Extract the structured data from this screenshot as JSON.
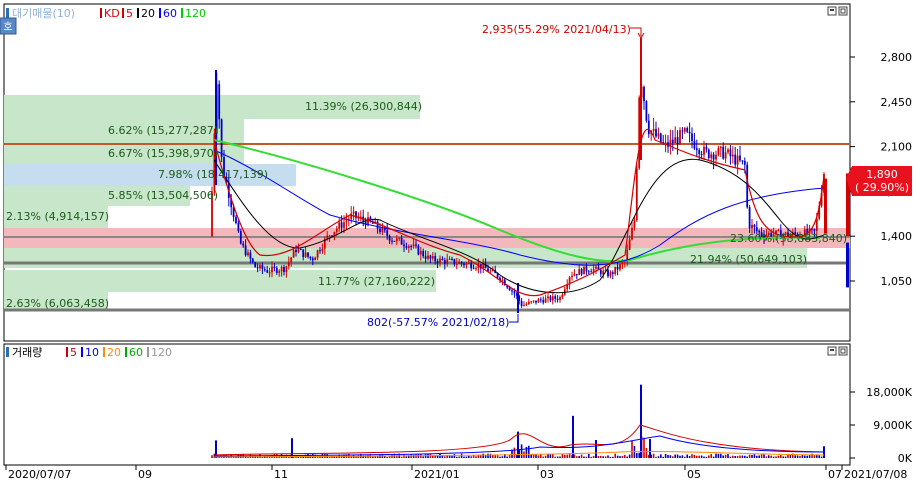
{
  "legend_price": {
    "title": "대기매물(10)",
    "items": [
      {
        "name": "KD",
        "color": "#d40000"
      },
      {
        "name": "5",
        "color": "#d40000"
      },
      {
        "name": "20",
        "color": "#000000"
      },
      {
        "name": "60",
        "color": "#0000ff"
      },
      {
        "name": "120",
        "color": "#00cc00"
      }
    ]
  },
  "legend_volume": {
    "title": "거래량",
    "items": [
      {
        "name": "5",
        "color": "#d40000"
      },
      {
        "name": "10",
        "color": "#0000ff"
      },
      {
        "name": "20",
        "color": "#ff8c00"
      },
      {
        "name": "60",
        "color": "#00aa00"
      },
      {
        "name": "120",
        "color": "#999999"
      }
    ]
  },
  "side_button": "호",
  "price_axis_labels": [
    "2,800",
    "2,450",
    "2,100",
    "1,750",
    "1,400",
    "1,050"
  ],
  "volume_axis_labels": [
    "18,000K",
    "9,000K",
    "0K"
  ],
  "date_labels": [
    "2020/07/07",
    "09",
    "11",
    "2021/01",
    "03",
    "05",
    "07",
    "2021/07/08"
  ],
  "current_price": {
    "price": "1,890",
    "change": "( 29.90%)"
  },
  "annotations": {
    "high": "2,935(55.29% 2021/04/13)",
    "low": "802(-57.57% 2021/02/18)"
  },
  "volume_profile": [
    {
      "label": "11.39% (26,300,844)"
    },
    {
      "label": "6.62% (15,277,287)"
    },
    {
      "label": "6.67% (15,398,970)"
    },
    {
      "label": "7.98% (18,417,139)"
    },
    {
      "label": "5.85% (13,504,506)"
    },
    {
      "label": "2.13% (4,914,157)"
    },
    {
      "label": "23.60% (53,883,840)"
    },
    {
      "label": "21.94% (50,649,103)"
    },
    {
      "label": "11.77% (27,160,222)"
    },
    {
      "label": "2.63% (6,063,458)"
    }
  ],
  "chart_data": {
    "type": "candlestick",
    "price_axis": {
      "ticks": [
        2800,
        2450,
        2100,
        1750,
        1400,
        1050
      ]
    },
    "volume_axis": {
      "ticks": [
        18000,
        9000,
        0
      ],
      "unit": "K"
    },
    "high": 2935,
    "low": 802,
    "last_close": 1890,
    "moving_averages": [
      "5",
      "20",
      "60",
      "120"
    ],
    "volume_profile_percent": [
      11.39,
      6.62,
      6.67,
      7.98,
      5.85,
      2.13,
      23.6,
      21.94,
      11.77,
      2.63
    ],
    "volume_profile_shares": [
      26300844,
      15277287,
      15398970,
      18417139,
      13504506,
      4914157,
      53883840,
      50649103,
      27160222,
      6063458
    ]
  },
  "colors": {
    "up": "#d40000",
    "down": "#0000cc",
    "profile_green": "#c8e6c9",
    "profile_blue": "#c6dcef",
    "profile_red": "#f2b8bc",
    "ma5": "#d40000",
    "ma20": "#000000",
    "ma60": "#0000ff",
    "ma120": "#33dd33"
  }
}
